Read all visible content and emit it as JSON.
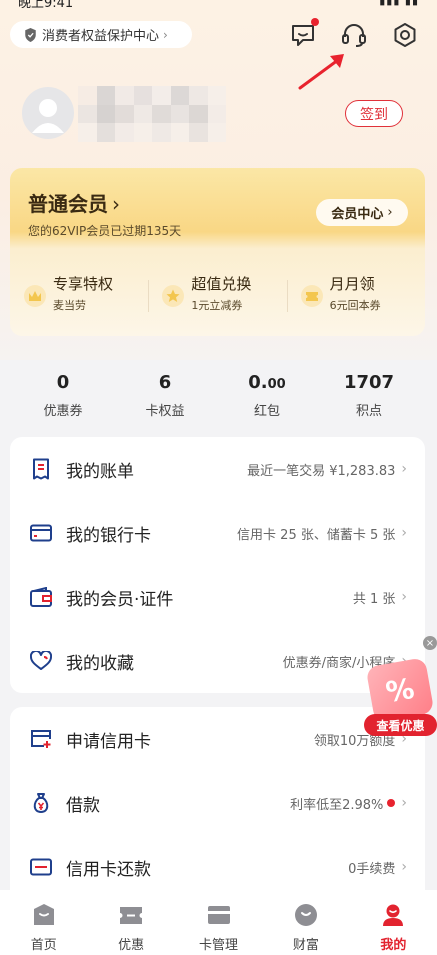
{
  "status_bar": {
    "time": "晚上9:41"
  },
  "header": {
    "protection_center": "消费者权益保护中心",
    "sign_in": "签到"
  },
  "member": {
    "title": "普通会员",
    "subtitle": "您的62VIP会员已过期135天",
    "center_button": "会员中心",
    "perks": [
      {
        "title": "专享特权",
        "sub": "麦当劳",
        "icon": "crown-icon"
      },
      {
        "title": "超值兑换",
        "sub": "1元立减券",
        "icon": "star-icon"
      },
      {
        "title": "月月领",
        "sub": "6元回本券",
        "icon": "ticket-icon"
      }
    ]
  },
  "stats": [
    {
      "value": "0",
      "label": "优惠券"
    },
    {
      "value": "6",
      "label": "卡权益"
    },
    {
      "value_main": "0.",
      "value_small": "00",
      "label": "红包"
    },
    {
      "value": "1707",
      "label": "积点"
    }
  ],
  "account_panel": [
    {
      "label": "我的账单",
      "right": "最近一笔交易 ¥1,283.83",
      "icon": "bill-icon"
    },
    {
      "label": "我的银行卡",
      "right": "信用卡 25 张、储蓄卡 5 张",
      "icon": "card-icon"
    },
    {
      "label": "我的会员·证件",
      "right": "共 1 张",
      "icon": "wallet-icon"
    },
    {
      "label": "我的收藏",
      "right": "优惠券/商家/小程序",
      "icon": "heart-icon"
    }
  ],
  "service_panel": [
    {
      "label": "申请信用卡",
      "right": "领取10万额度",
      "icon": "add-card-icon"
    },
    {
      "label": "借款",
      "right": "利率低至2.98%",
      "icon": "money-bag-icon"
    },
    {
      "label": "信用卡还款",
      "right": "0手续费",
      "icon": "repay-card-icon"
    }
  ],
  "promo": {
    "label": "查看优惠",
    "glyph": "%"
  },
  "tabbar": [
    {
      "label": "首页",
      "icon": "home-icon"
    },
    {
      "label": "优惠",
      "icon": "discount-icon"
    },
    {
      "label": "卡管理",
      "icon": "card-manage-icon"
    },
    {
      "label": "财富",
      "icon": "wealth-icon"
    },
    {
      "label": "我的",
      "icon": "profile-icon"
    }
  ],
  "colors": {
    "brand_red": "#e2232f",
    "gold": "#f9d785"
  }
}
